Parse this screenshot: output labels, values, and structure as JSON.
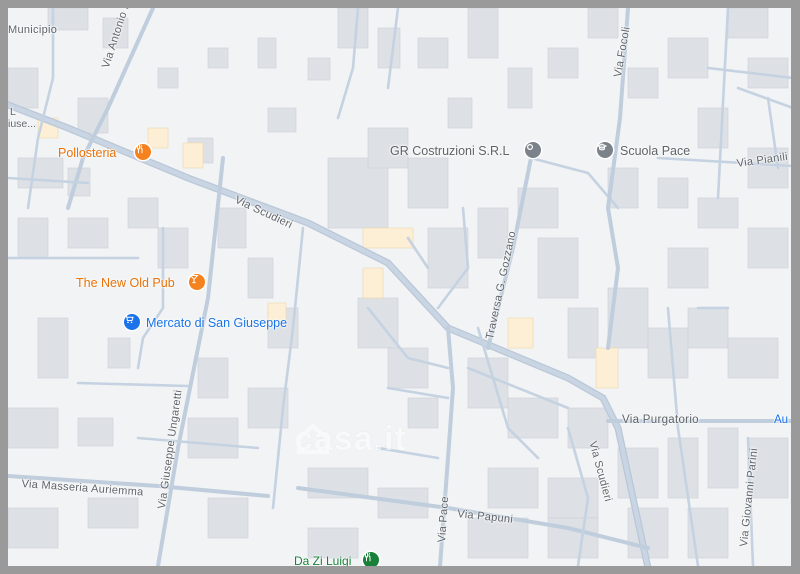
{
  "streets": {
    "municipio": "Municipio",
    "via_antonio_nappo": "Via Antonio Nappo",
    "via_scudieri_top": "Via Scudieri",
    "via_scudieri_bottom": "Via Scudieri",
    "via_focoli": "Via Focoli",
    "via_pianili": "Via Pianili",
    "traversa_gozzano": "Traversa G. Gozzano",
    "via_giuseppe_ungaretti": "Via Giuseppe Ungaretti",
    "via_masseria_auriemma": "Via Masseria Auriemma",
    "via_pace": "Via Pace",
    "via_papuni": "Via Papuni",
    "via_purgatorio": "Via Purgatorio",
    "via_giovanni_parini": "Via Giovanni Parini",
    "edge_au": "Au",
    "edge_l": "L",
    "edge_giuse": "iuse..."
  },
  "pois": {
    "pollosteria": {
      "label": "Pollosteria",
      "icon": "restaurant-icon"
    },
    "new_old_pub": {
      "label": "The New Old Pub",
      "icon": "cocktail-icon"
    },
    "mercato": {
      "label": "Mercato di San Giuseppe",
      "icon": "shopping-cart-icon"
    },
    "gr_costruzioni": {
      "label": "GR Costruzioni S.R.L",
      "icon": "place-icon"
    },
    "scuola_pace": {
      "label": "Scuola Pace",
      "icon": "school-icon"
    },
    "da_zi_luigi": {
      "label": "Da Zi Luigi",
      "icon": "restaurant-icon"
    }
  },
  "watermark": {
    "text": "casa.it"
  },
  "colors": {
    "background": "#f1f3f4",
    "road": "#bfcddd",
    "building": "#dde1e6",
    "highlight_building": "#fcefd5",
    "poi_orange": "#e8710a",
    "poi_blue": "#1a73e8",
    "poi_green": "#188038"
  }
}
